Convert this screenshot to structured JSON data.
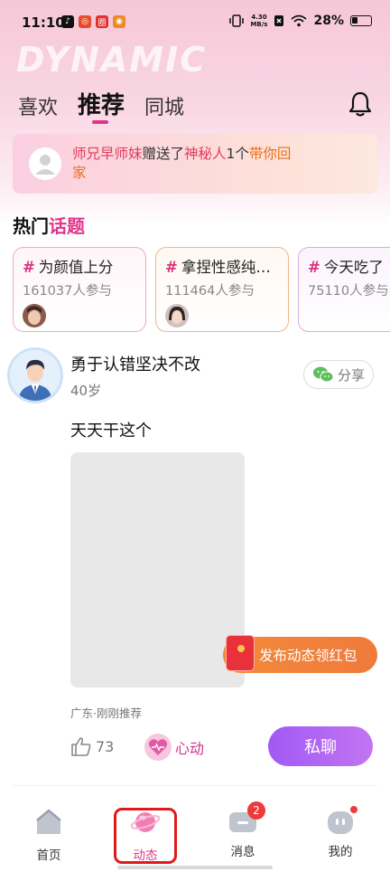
{
  "status": {
    "time": "11:10",
    "net_speed_value": "4.30",
    "net_speed_unit": "MB/s",
    "battery": "28%"
  },
  "header": {
    "watermark": "DYNAMIC",
    "tabs": [
      {
        "label": "喜欢",
        "active": false
      },
      {
        "label": "推荐",
        "active": true
      },
      {
        "label": "同城",
        "active": false
      }
    ]
  },
  "gift_banner": {
    "sender": "师兄早师妹",
    "verb": "赠送了",
    "receiver": "神秘人",
    "count": "1个",
    "gift": "带你回家"
  },
  "hot_topics": {
    "title_part1": "热门",
    "title_part2": "话题",
    "items": [
      {
        "name": "为颜值上分",
        "count": "161037人参与"
      },
      {
        "name": "拿捏性感纯欲风",
        "count": "111464人参与"
      },
      {
        "name": "今天吃了",
        "count": "75110人参与"
      }
    ]
  },
  "post": {
    "username": "勇于认错坚决不改",
    "age": "40岁",
    "share_label": "分享",
    "text": "天天干这个",
    "meta": "广东·刚刚推荐",
    "likes": "73",
    "heartbeat_label": "心动",
    "chat_label": "私聊"
  },
  "promo": {
    "label": "发布动态领红包"
  },
  "bottom_nav": [
    {
      "label": "首页"
    },
    {
      "label": "动态"
    },
    {
      "label": "消息",
      "badge": "2"
    },
    {
      "label": "我的"
    }
  ],
  "colors": {
    "accent_pink": "#e0358a",
    "chat_purple": "#a259f4",
    "promo_orange": "#f28a3a"
  }
}
